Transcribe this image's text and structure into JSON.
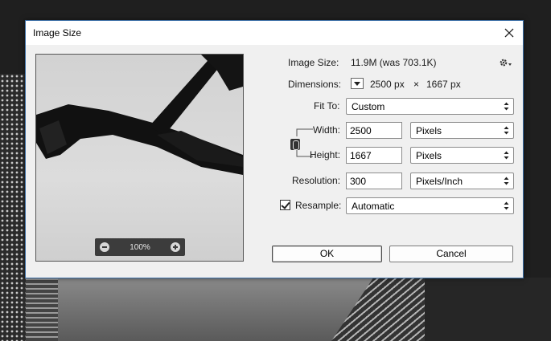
{
  "dialog": {
    "title": "Image Size"
  },
  "preview": {
    "zoom": "100%"
  },
  "info": {
    "image_size_label": "Image Size:",
    "image_size_value": "11.9M (was 703.1K)",
    "dimensions_label": "Dimensions:",
    "dimensions_width": "2500 px",
    "dimensions_sep": "×",
    "dimensions_height": "1667 px"
  },
  "fit_to": {
    "label": "Fit To:",
    "value": "Custom"
  },
  "width": {
    "label": "Width:",
    "value": "2500",
    "unit": "Pixels"
  },
  "height": {
    "label": "Height:",
    "value": "1667",
    "unit": "Pixels"
  },
  "resolution": {
    "label": "Resolution:",
    "value": "300",
    "unit": "Pixels/Inch"
  },
  "resample": {
    "label": "Resample:",
    "checked": true,
    "value": "Automatic"
  },
  "buttons": {
    "ok": "OK",
    "cancel": "Cancel"
  },
  "colors": {
    "dialog_bg": "#f0f0f0",
    "border_accent": "#3b6ea5"
  }
}
